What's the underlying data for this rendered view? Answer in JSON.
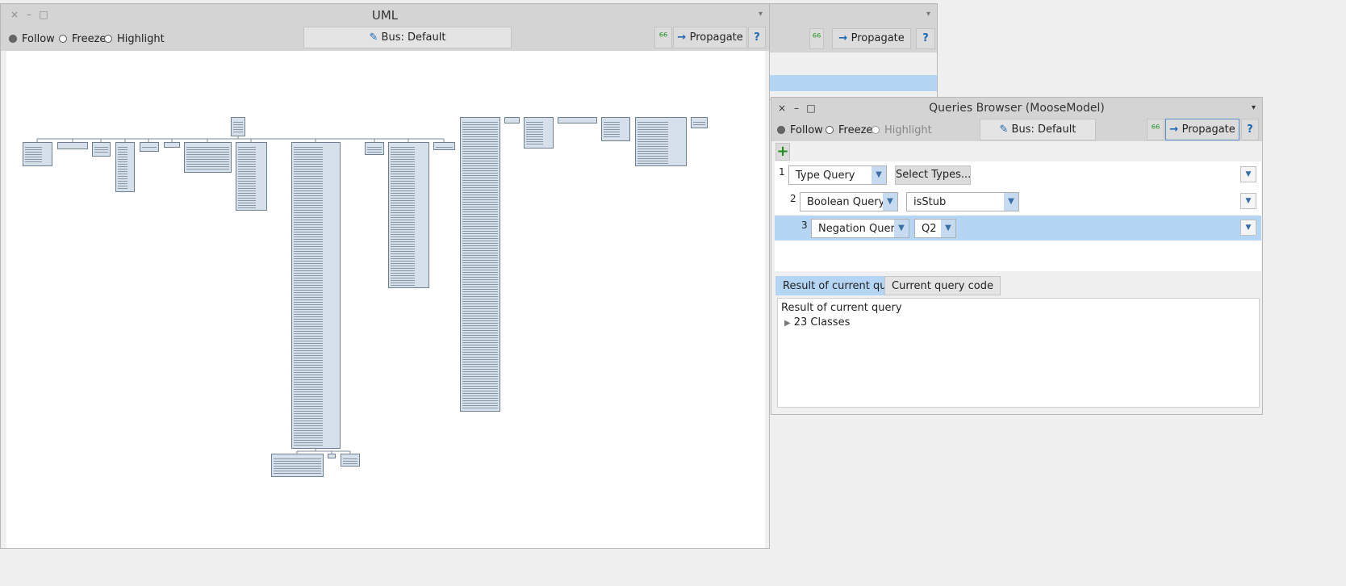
{
  "windows": {
    "back": {
      "propagate_label": "Propagate",
      "help_label": "?"
    },
    "uml": {
      "title": "UML",
      "close": "×",
      "minimize": "–",
      "maximize": "□",
      "menu": "▾",
      "follow_label": "Follow",
      "freeze_label": "Freeze",
      "highlight_label": "Highlight",
      "bus_label": "Bus: Default",
      "propagate_label": "Propagate",
      "help_label": "?"
    },
    "queries": {
      "title": "Queries Browser (MooseModel)",
      "close": "×",
      "minimize": "–",
      "maximize": "□",
      "menu": "▾",
      "follow_label": "Follow",
      "freeze_label": "Freeze",
      "highlight_label": "Highlight",
      "bus_label": "Bus: Default",
      "propagate_label": "Propagate",
      "help_label": "?",
      "add_label": "+",
      "rows": [
        {
          "num": "1",
          "query": "Type Query",
          "param": "Select Types..."
        },
        {
          "num": "2",
          "query": "Boolean Query",
          "param": "isStub"
        },
        {
          "num": "3",
          "query": "Negation Query",
          "param": "Q2"
        }
      ],
      "tabs": [
        "Result of current query",
        "Current query code"
      ],
      "result_heading": "Result of current query",
      "result_item": "23 Classes"
    }
  },
  "colors": {
    "selection": "#b5d5f5",
    "accent": "#1b67b5",
    "uml_fill": "#d6e0ea"
  }
}
